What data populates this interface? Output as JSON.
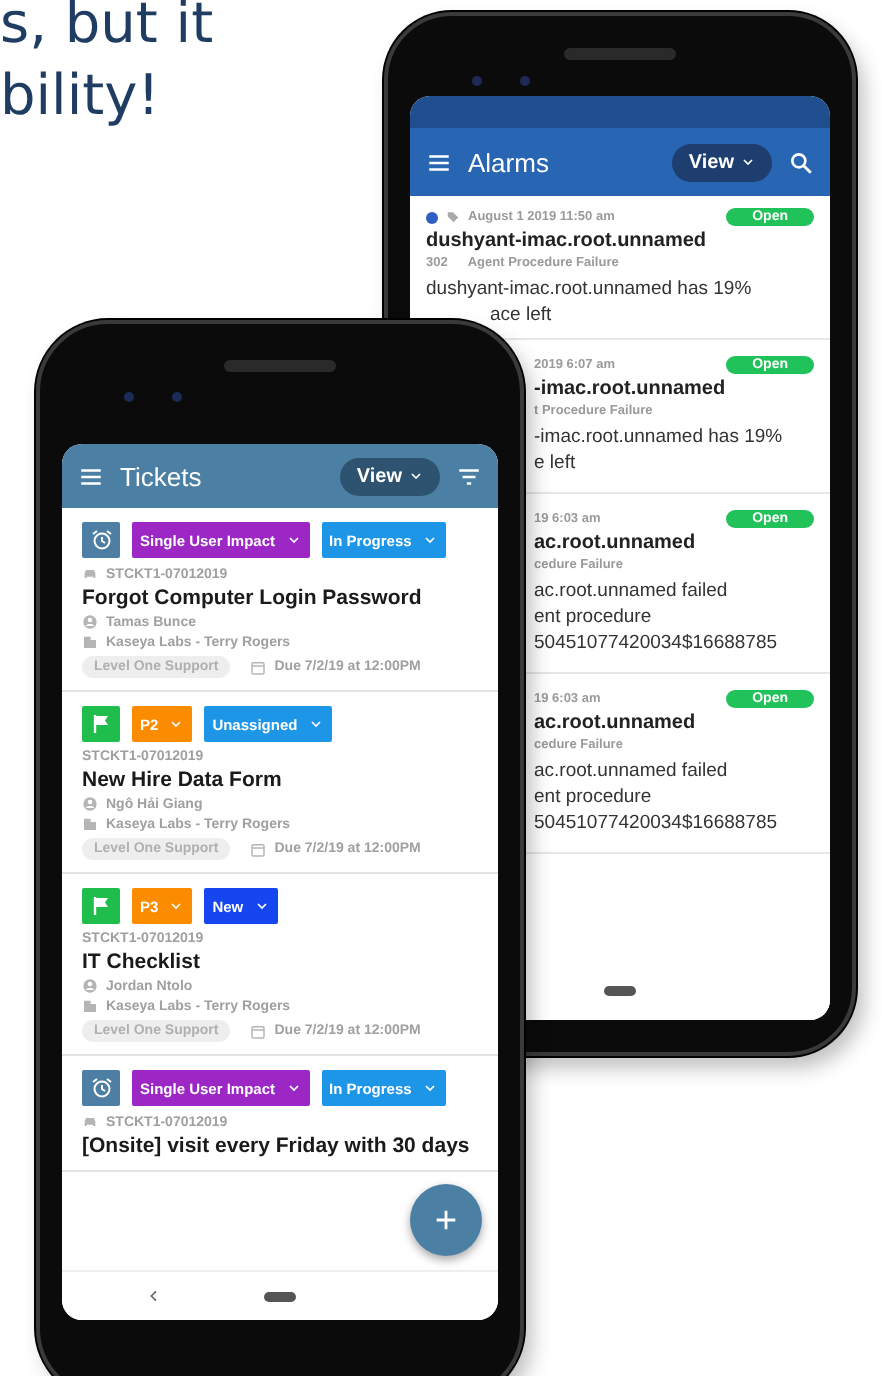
{
  "headline_lines": [
    "s, but it",
    "bility!"
  ],
  "alarms_screen": {
    "title": "Alarms",
    "view_button": "View",
    "alarms": [
      {
        "unread": true,
        "time": "August 1 2019 11:50 am",
        "status": "Open",
        "title": "dushyant-imac.root.unnamed",
        "code": "302",
        "type": "Agent Procedure Failure",
        "description_lines": [
          "dushyant-imac.root.unnamed has 19%",
          "ace left"
        ]
      },
      {
        "time": "2019 6:07 am",
        "status": "Open",
        "title": "-imac.root.unnamed",
        "type": "t Procedure Failure",
        "description_lines": [
          "-imac.root.unnamed has 19%",
          "e left"
        ]
      },
      {
        "time": "19 6:03 am",
        "status": "Open",
        "title": "ac.root.unnamed",
        "type": "cedure Failure",
        "description_lines": [
          "ac.root.unnamed failed",
          "ent procedure",
          "50451077420034$16688785"
        ]
      },
      {
        "time": "19 6:03 am",
        "status": "Open",
        "title": "ac.root.unnamed",
        "type": "cedure Failure",
        "description_lines": [
          "ac.root.unnamed failed",
          "ent procedure",
          "50451077420034$16688785"
        ]
      }
    ]
  },
  "tickets_screen": {
    "title": "Tickets",
    "view_button": "View",
    "tickets": [
      {
        "kind": "alarm",
        "priority": {
          "label": "Single User Impact",
          "color": "#9c27c4"
        },
        "status": {
          "label": "In Progress",
          "color": "#1e96e8"
        },
        "vehicle": true,
        "id": "STCKT1-07012019",
        "title": "Forgot Computer Login Password",
        "assignee": "Tamas Bunce",
        "company": "Kaseya Labs - Terry Rogers",
        "tag": "Level One Support",
        "due": "Due 7/2/19 at 12:00PM"
      },
      {
        "kind": "flag",
        "priority": {
          "label": "P2",
          "color": "#fb8c00"
        },
        "status": {
          "label": "Unassigned",
          "color": "#1e96e8"
        },
        "vehicle": false,
        "id": "STCKT1-07012019",
        "title": "New Hire Data Form",
        "assignee": "Ngô Hải Giang",
        "company": "Kaseya Labs - Terry Rogers",
        "tag": "Level One Support",
        "due": "Due 7/2/19 at 12:00PM"
      },
      {
        "kind": "flag",
        "priority": {
          "label": "P3",
          "color": "#fb8c00"
        },
        "status": {
          "label": "New",
          "color": "#1546f0"
        },
        "vehicle": false,
        "id": "STCKT1-07012019",
        "title": "IT Checklist",
        "assignee": "Jordan Ntolo",
        "company": "Kaseya Labs - Terry Rogers",
        "tag": "Level One Support",
        "due": "Due 7/2/19 at 12:00PM"
      },
      {
        "kind": "alarm",
        "priority": {
          "label": "Single User Impact",
          "color": "#9c27c4"
        },
        "status": {
          "label": "In Progress",
          "color": "#1e96e8"
        },
        "vehicle": true,
        "id": "STCKT1-07012019",
        "title": "[Onsite] visit every Friday with 30 days"
      }
    ]
  }
}
